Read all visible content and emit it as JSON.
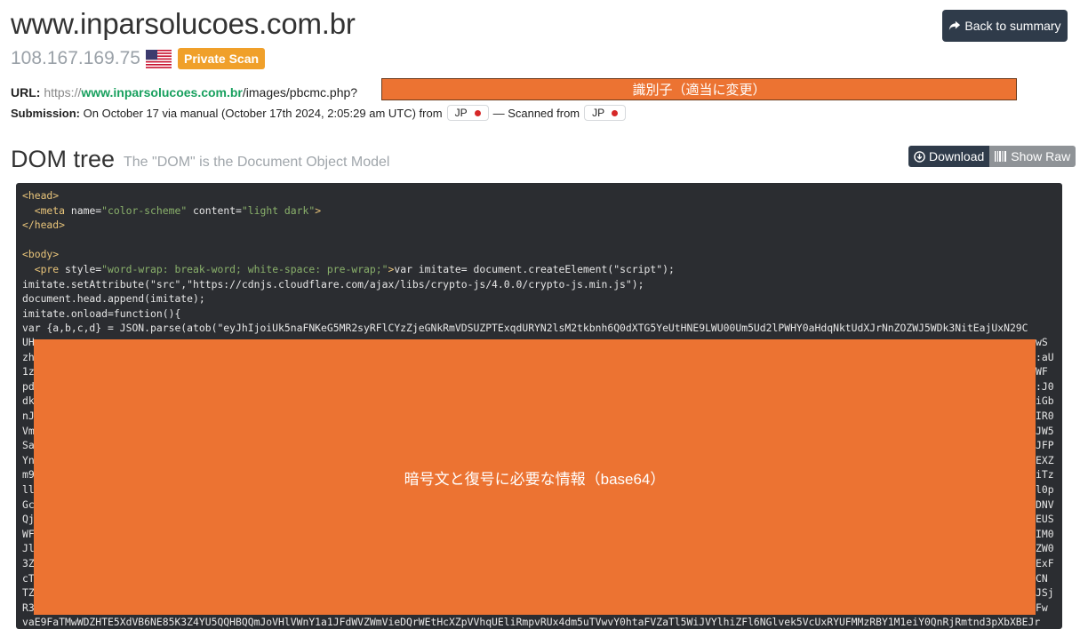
{
  "header": {
    "domain": "www.inparsolucoes.com.br",
    "back_label": "Back to summary",
    "ip": "108.167.169.75",
    "private_label": "Private Scan"
  },
  "url": {
    "label": "URL:",
    "scheme": "https://",
    "host": "www.inparsolucoes.com.br",
    "path": "/images/pbcmc.php?",
    "redaction_note": "識別子（適当に変更）"
  },
  "submission": {
    "label": "Submission:",
    "text": "On October 17 via manual (October 17th 2024, 2:05:29 am UTC) from",
    "from_cc": "JP",
    "scanned_text": "— Scanned from",
    "scanned_cc": "JP"
  },
  "dom": {
    "title": "DOM tree",
    "subtitle": "The \"DOM\" is the Document Object Model",
    "download_label": "Download",
    "raw_label": "Show Raw",
    "redaction_note": "暗号文と復号に必要な情報（base64）",
    "left_fragments": [
      "UH",
      "zh",
      "1z",
      "pd",
      "dk",
      "nJ",
      "Vm",
      "Sa",
      "Yn",
      "m9",
      "ll",
      "Gc",
      "Qj",
      "WF",
      "Jl",
      "3Z",
      "cT",
      "TZ",
      "R3"
    ],
    "right_fragments": [
      "wS",
      ":aU",
      "WF",
      ":J0",
      "iGb",
      "IR0",
      "JW5",
      "JFP",
      "EXZ",
      "iTz",
      "l0p",
      "DNV",
      "EUS",
      "IM0",
      "ZW0",
      "ExF",
      "CN",
      "JSj",
      "Fw"
    ],
    "bottom_line": "vaE9FaTMwWDZHTE5XdVB6NE85K3Z4YU5QQHBQQmJoVHlVWnY1a1JFdWVZWmVieDQrWEtHcXZpVVhqUEliRmpvRUx4dm5uTVwvY0htaFVZaTl5WiJVYlhiZFl6NGlvek5VcUxRYUFMMzRBY1M1eiY0QnRjRmtnd3pXbXBEJr"
  },
  "colors": {
    "accent_green": "#18a05e",
    "badge_orange": "#f0a02a",
    "redaction_orange": "#ec7332",
    "dark_button": "#2f3b4a",
    "code_bg": "#2b2d31"
  }
}
